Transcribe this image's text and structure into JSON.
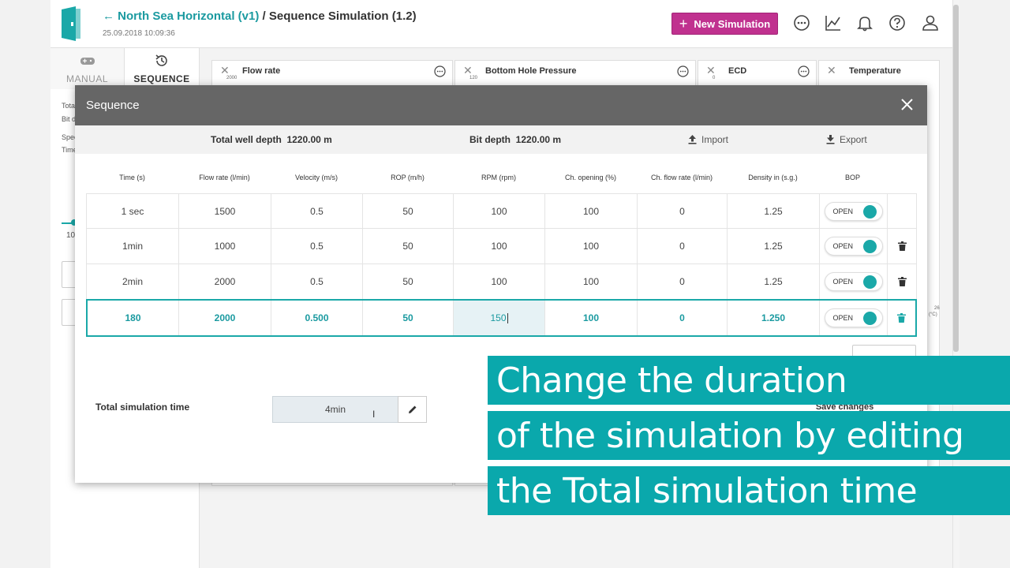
{
  "header": {
    "back_arrow": "←",
    "project_link": "North Sea Horizontal (v1)",
    "separator": " / ",
    "page_title": "Sequence Simulation (1.2)",
    "timestamp": "25.09.2018 10:09:36",
    "new_simulation_label": "New Simulation",
    "icons": [
      "more-icon",
      "chart-icon",
      "bell-icon",
      "help-icon",
      "user-icon"
    ]
  },
  "left_panel": {
    "tabs": [
      {
        "label": "MANUAL",
        "icon": "gamepad-icon"
      },
      {
        "label": "SEQUENCE",
        "icon": "history-icon"
      }
    ],
    "snippets": [
      "Tota",
      "Bit d",
      "Spee",
      "Time",
      "10"
    ]
  },
  "charts": [
    {
      "name": "Flow rate",
      "max": "2000"
    },
    {
      "name": "Bottom Hole Pressure",
      "max": "120"
    },
    {
      "name": "ECD",
      "max": "0"
    },
    {
      "name": "Temperature",
      "max": ""
    }
  ],
  "chart_fragments": {
    "right_axis_top": "26",
    "right_axis_unit": "(°C)"
  },
  "modal": {
    "title": "Sequence",
    "total_well_depth_label": "Total well depth",
    "total_well_depth_value": "1220.00 m",
    "bit_depth_label": "Bit depth",
    "bit_depth_value": "1220.00 m",
    "import_label": "Import",
    "export_label": "Export",
    "columns": [
      "Time (s)",
      "Flow rate (l/min)",
      "Velocity (m/s)",
      "ROP (m/h)",
      "RPM (rpm)",
      "Ch. opening (%)",
      "Ch. flow rate (l/min)",
      "Density in (s.g.)",
      "BOP"
    ],
    "rows": [
      {
        "time": "1 sec",
        "flow": "1500",
        "velocity": "0.5",
        "rop": "50",
        "rpm": "100",
        "ch_opening": "100",
        "ch_flow": "0",
        "density": "1.25",
        "bop": "OPEN",
        "deletable": false
      },
      {
        "time": "1min",
        "flow": "1000",
        "velocity": "0.5",
        "rop": "50",
        "rpm": "100",
        "ch_opening": "100",
        "ch_flow": "0",
        "density": "1.25",
        "bop": "OPEN",
        "deletable": true
      },
      {
        "time": "2min",
        "flow": "2000",
        "velocity": "0.5",
        "rop": "50",
        "rpm": "100",
        "ch_opening": "100",
        "ch_flow": "0",
        "density": "1.25",
        "bop": "OPEN",
        "deletable": true
      },
      {
        "time": "180",
        "flow": "2000",
        "velocity": "0.500",
        "rop": "50",
        "rpm": "150",
        "ch_opening": "100",
        "ch_flow": "0",
        "density": "1.250",
        "bop": "OPEN",
        "deletable": true,
        "selected": true
      }
    ],
    "total_simulation_time_label": "Total simulation time",
    "total_simulation_time_value": "4min",
    "save_label": "Save changes"
  },
  "caption": {
    "line1": "Change the duration",
    "line2": "of the simulation by editing",
    "line3": "the Total simulation time"
  },
  "colors": {
    "accent": "#1aa8a8",
    "brand": "#c0318f",
    "caption_bg": "#0aa8ac",
    "modal_header": "#666666"
  }
}
